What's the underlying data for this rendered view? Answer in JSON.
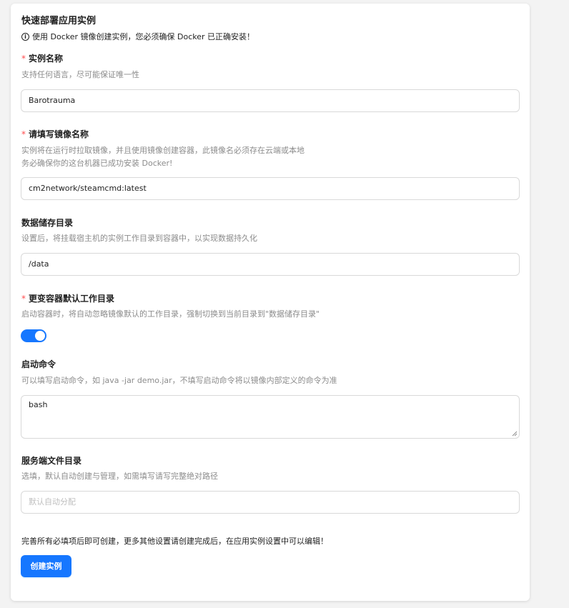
{
  "form": {
    "title": "快速部署应用实例",
    "notice": "使用 Docker 镜像创建实例，您必须确保 Docker 已正确安装！",
    "required_mark": "*",
    "instance_name": {
      "label": "实例名称",
      "desc": "支持任何语言，尽可能保证唯一性",
      "value": "Barotrauma"
    },
    "image_name": {
      "label": "请填写镜像名称",
      "desc_line1": "实例将在运行时拉取镜像，并且使用镜像创建容器，此镜像名必须存在云端或本地",
      "desc_line2": "务必确保你的这台机器已成功安装 Docker!",
      "value": "cm2network/steamcmd:latest"
    },
    "data_dir": {
      "label": "数据储存目录",
      "desc": "设置后，将挂载宿主机的实例工作目录到容器中，以实现数据持久化",
      "value": "/data"
    },
    "change_workdir": {
      "label": "更变容器默认工作目录",
      "desc": "启动容器时，将自动忽略镜像默认的工作目录，强制切换到当前目录到\"数据储存目录\"",
      "enabled": true
    },
    "start_command": {
      "label": "启动命令",
      "desc": "可以填写启动命令，如 java -jar demo.jar，不填写启动命令将以镜像内部定义的命令为准",
      "value": "bash"
    },
    "server_dir": {
      "label": "服务端文件目录",
      "desc": "选填，默认自动创建与管理，如需填写请写完整绝对路径",
      "placeholder": "默认自动分配"
    },
    "footer_note": "完善所有必填项后即可创建，更多其他设置请创建完成后，在应用实例设置中可以编辑！",
    "submit_label": "创建实例",
    "accent_color": "#1677ff",
    "required_color": "#ff4d4f",
    "info_icon": "info-circle-icon"
  }
}
